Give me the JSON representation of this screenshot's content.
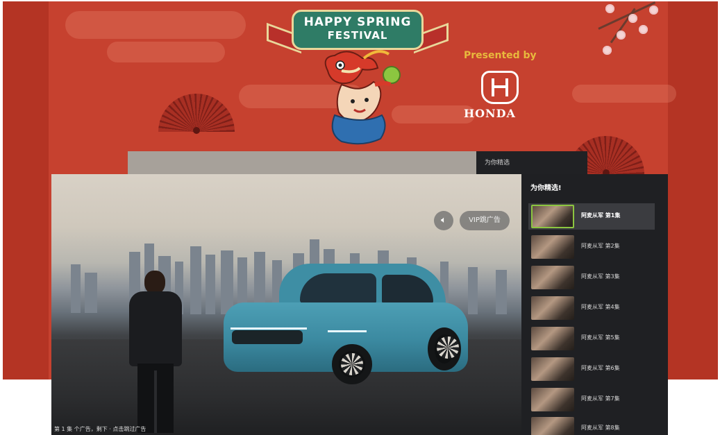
{
  "banner": {
    "title_line1": "HAPPY SPRING",
    "title_line2": "FESTIVAL",
    "presented_by": "Presented by",
    "sponsor_name": "HONDA",
    "colors": {
      "background": "#c6412f",
      "ribbon": "#2f7c66",
      "presented_text": "#e8b93d"
    }
  },
  "back_panel": {
    "title": "为你精选"
  },
  "player": {
    "vip_label": "VIP跳广告",
    "mute_icon": "speaker-icon",
    "ad_caption": "第 1 集 个广告，剩下 · 点击跳过广告"
  },
  "playlist": {
    "title": "为你精选!",
    "items": [
      {
        "label": "阿麦从军 第1集",
        "active": true
      },
      {
        "label": "阿麦从军 第2集",
        "active": false
      },
      {
        "label": "阿麦从军 第3集",
        "active": false
      },
      {
        "label": "阿麦从军 第4集",
        "active": false
      },
      {
        "label": "阿麦从军 第5集",
        "active": false
      },
      {
        "label": "阿麦从军 第6集",
        "active": false
      },
      {
        "label": "阿麦从军 第7集",
        "active": false
      },
      {
        "label": "阿麦从军 第8集",
        "active": false
      }
    ]
  }
}
